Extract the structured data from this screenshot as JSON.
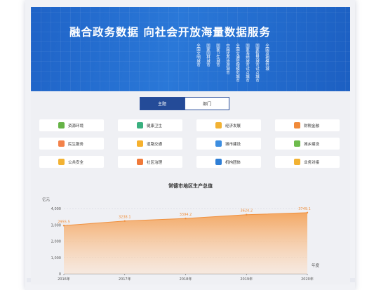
{
  "banner": {
    "title": "融合政务数据  向社会开放海量数据服务",
    "vertical_labels": [
      "全国文明城市",
      "国家园林城市",
      "国家卫生城市",
      "中国优秀旅游城市",
      "全国交通管理模范城市",
      "国家海绵城市试点城市",
      "国家智慧城市试点城市",
      "全国双拥模范城"
    ]
  },
  "tabs": [
    {
      "label": "主题",
      "active": true
    },
    {
      "label": "部门",
      "active": false
    }
  ],
  "categories": [
    {
      "label": "资源环境",
      "icon": "leaf-chart-icon",
      "color": "#65b346"
    },
    {
      "label": "健康卫生",
      "icon": "medical-kit-icon",
      "color": "#3ab07f"
    },
    {
      "label": "经济发展",
      "icon": "money-icon",
      "color": "#f2b233"
    },
    {
      "label": "财税金融",
      "icon": "finance-icon",
      "color": "#f08a3a"
    },
    {
      "label": "民生服务",
      "icon": "people-service-icon",
      "color": "#f3824a"
    },
    {
      "label": "道路交通",
      "icon": "road-icon",
      "color": "#f6b12e"
    },
    {
      "label": "城市建设",
      "icon": "city-building-icon",
      "color": "#3d8ee0"
    },
    {
      "label": "城乡建设",
      "icon": "sprout-icon",
      "color": "#6dbb4c"
    },
    {
      "label": "公共安全",
      "icon": "shield-icon",
      "color": "#f2b233"
    },
    {
      "label": "社区治理",
      "icon": "community-icon",
      "color": "#f07a3a"
    },
    {
      "label": "机构团体",
      "icon": "organization-icon",
      "color": "#2f7fd6"
    },
    {
      "label": "业务对接",
      "icon": "user-connect-icon",
      "color": "#f2b233"
    }
  ],
  "chart_data": {
    "type": "area",
    "title": "常德市地区生产总值",
    "ylabel": "亿元",
    "xlabel": "年度",
    "categories": [
      "2016年",
      "2017年",
      "2018年",
      "2019年",
      "2020年"
    ],
    "values": [
      2955.5,
      3238.1,
      3394.2,
      3624.2,
      3749.1
    ],
    "value_labels": [
      "2955.5",
      "3238.1",
      "3394.2",
      "3624.2",
      "3749.1"
    ],
    "yticks": [
      "0",
      "1,000",
      "2,000",
      "3,000",
      "4,000"
    ],
    "ylim": [
      0,
      4000
    ],
    "color": "#f4a45c",
    "grid": true,
    "legend": "none"
  }
}
